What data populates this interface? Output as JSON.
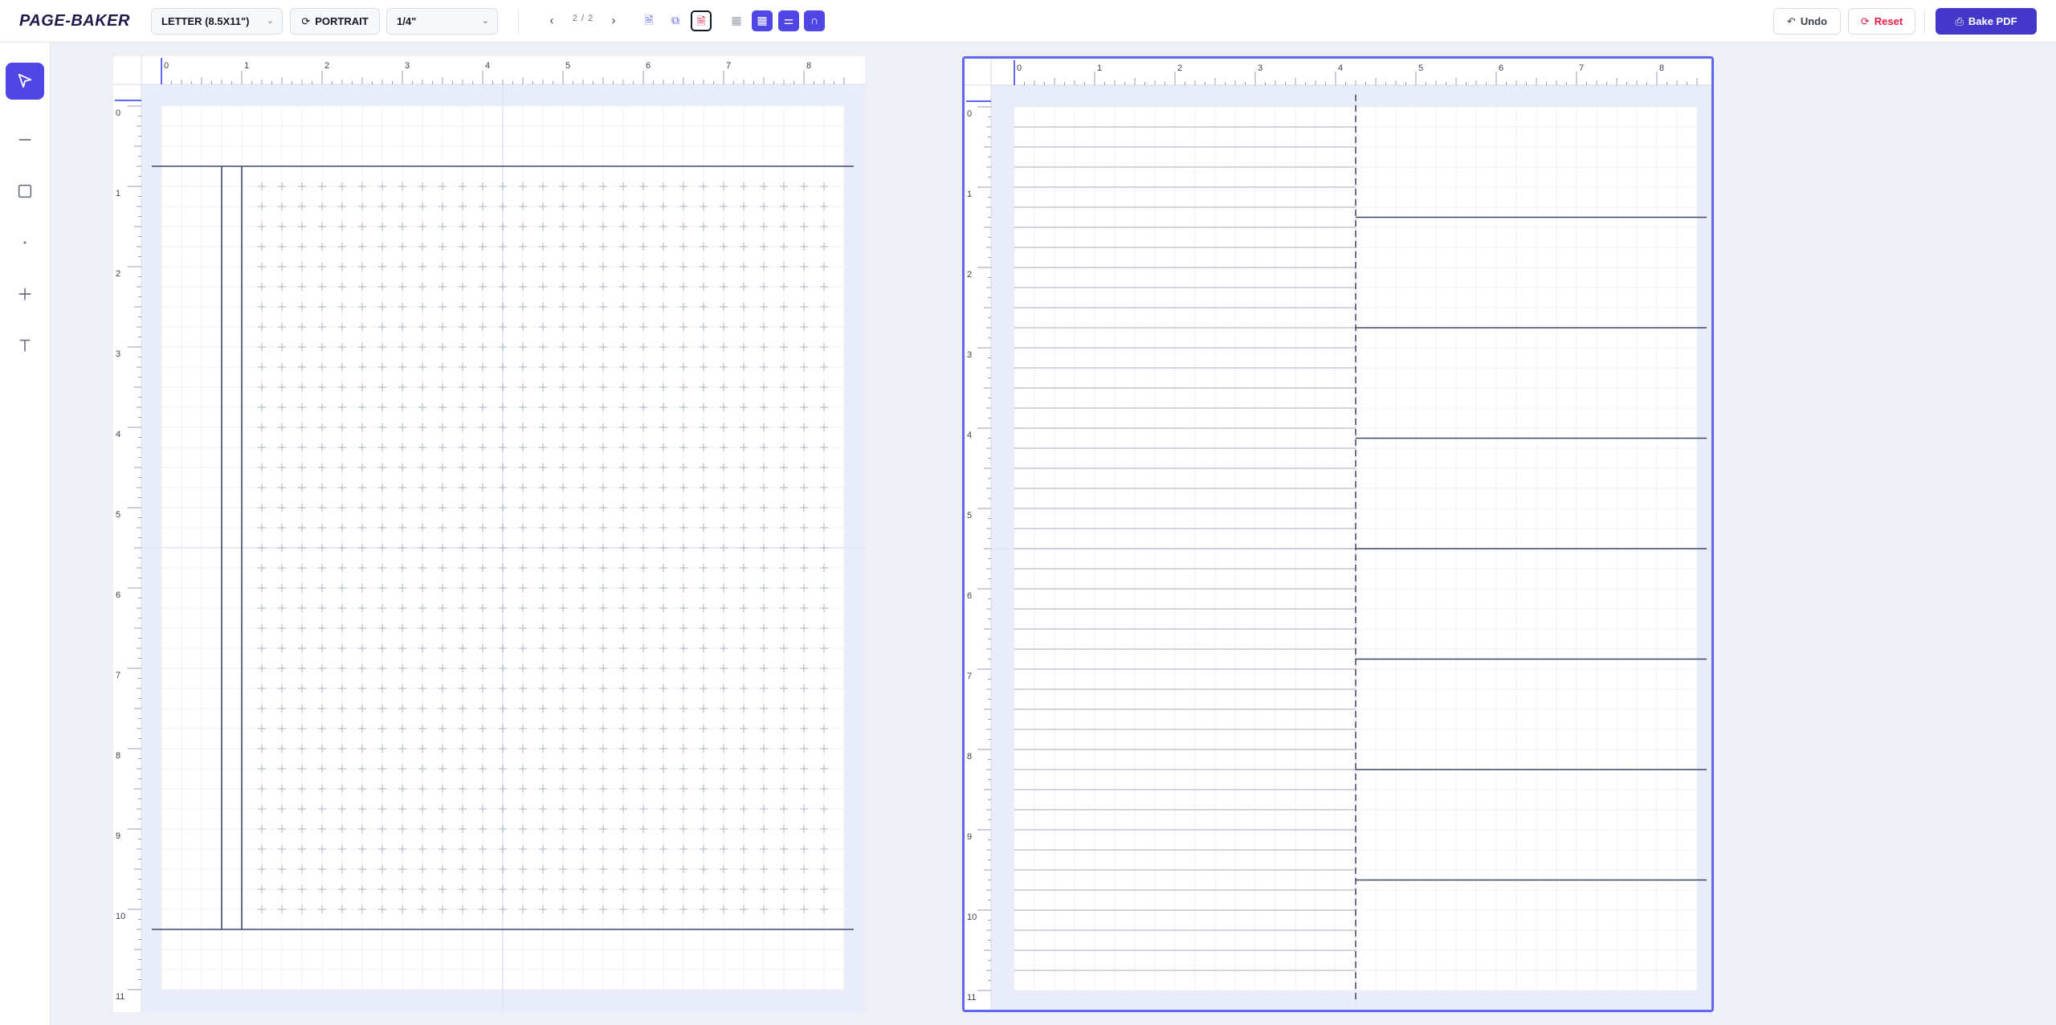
{
  "app": {
    "title": "PAGE-BAKER"
  },
  "toolbar": {
    "paper_size": "LETTER (8.5X11\")",
    "orientation_label": "PORTRAIT",
    "spacing": "1/4\"",
    "page_counter": "2 / 2",
    "undo_label": "Undo",
    "reset_label": "Reset",
    "bake_label": "Bake PDF"
  },
  "tools": [
    {
      "name": "select-tool",
      "icon": "cursor-icon",
      "active": true
    },
    {
      "name": "line-tool",
      "icon": "line-icon",
      "active": false
    },
    {
      "name": "rectangle-tool",
      "icon": "square-icon",
      "active": false
    },
    {
      "name": "dot-tool",
      "icon": "dot-icon",
      "active": false
    },
    {
      "name": "cross-tool",
      "icon": "plus-icon",
      "active": false
    },
    {
      "name": "text-tool",
      "icon": "text-icon",
      "active": false
    }
  ],
  "pages": [
    {
      "name": "page-1",
      "selected": false,
      "ruler_h": [
        "0",
        "1",
        "2",
        "3",
        "4",
        "5",
        "6",
        "7",
        "8"
      ],
      "ruler_v": [
        "0",
        "1",
        "2",
        "3",
        "4",
        "5",
        "6",
        "7",
        "8",
        "9",
        "10",
        "11"
      ],
      "layout": "cross-grid",
      "lines_in": {
        "top": 0.75,
        "bottom": 10.25,
        "left_margin_1": 0.75,
        "left_margin_2": 1.0
      },
      "cross_grid_in": {
        "x_start": 1.25,
        "x_end": 8.25,
        "y_start": 1.0,
        "y_end": 10.0,
        "step": 0.25
      }
    },
    {
      "name": "page-2",
      "selected": true,
      "ruler_h": [
        "0",
        "1",
        "2",
        "3",
        "4",
        "5",
        "6",
        "7",
        "8"
      ],
      "ruler_v": [
        "0",
        "1",
        "2",
        "3",
        "4",
        "5",
        "6",
        "7",
        "8",
        "9",
        "10",
        "11"
      ],
      "layout": "lined-split",
      "lines_in": {
        "left_rule_step": 0.25,
        "left_rule_start": 0.25,
        "left_rule_end": 10.75,
        "split_x": 4.25,
        "right_rules": [
          1.375,
          2.75,
          4.125,
          5.5,
          6.875,
          8.25,
          9.625
        ]
      }
    }
  ],
  "colors": {
    "accent": "#4f46e5",
    "danger": "#e11d48",
    "line": "#3d4766",
    "ruler_mark": "#6366f1"
  }
}
